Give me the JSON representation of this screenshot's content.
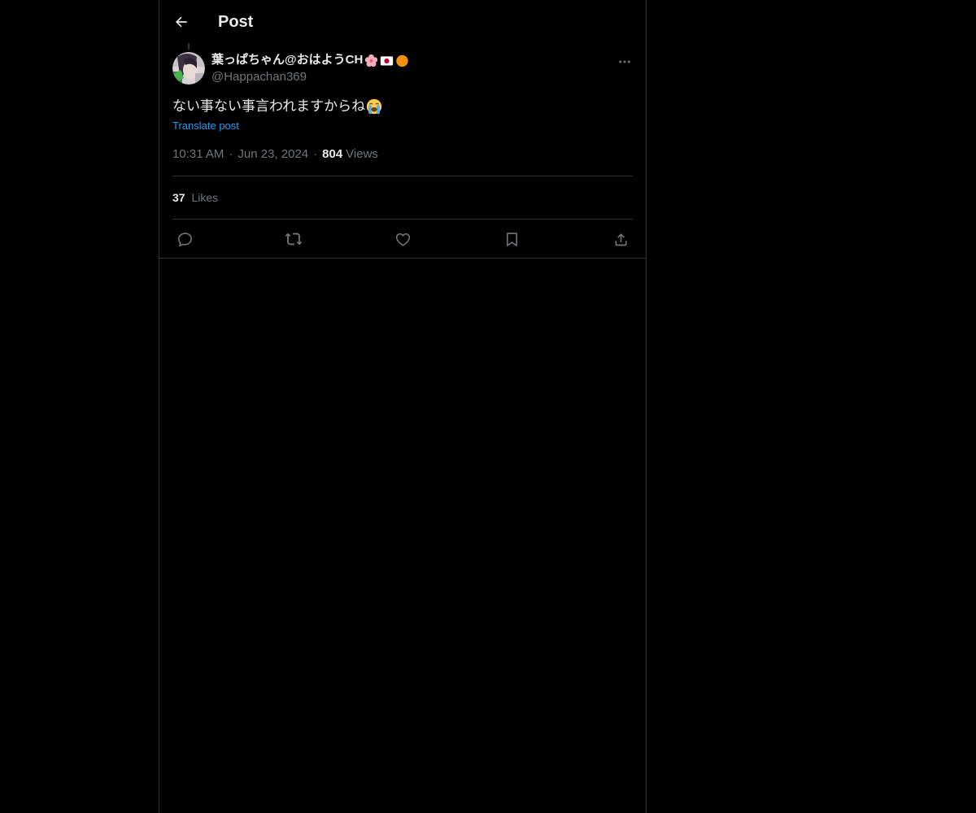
{
  "header": {
    "title": "Post",
    "back_icon": "arrow-left-icon"
  },
  "post": {
    "author": {
      "display_name": "葉っぱちゃん@おはようCH",
      "badges": [
        "cherry-blossom-emoji",
        "japan-flag-emoji",
        "orange-circle-emoji"
      ],
      "handle": "@Happachan369"
    },
    "text": "ない事ない事言われますからね",
    "text_emoji": "loudly-crying-face-emoji",
    "translate_label": "Translate post",
    "time": "10:31 AM",
    "date": "Jun 23, 2024",
    "separator": "·",
    "views_count": "804",
    "views_label": "Views",
    "likes_count": "37",
    "likes_label": "Likes"
  },
  "actions": [
    {
      "name": "reply",
      "icon": "reply-icon"
    },
    {
      "name": "repost",
      "icon": "repost-icon"
    },
    {
      "name": "like",
      "icon": "heart-icon"
    },
    {
      "name": "bookmark",
      "icon": "bookmark-icon"
    },
    {
      "name": "share",
      "icon": "share-icon"
    }
  ],
  "colors": {
    "background": "#000000",
    "text_primary": "#e7e9ea",
    "text_secondary": "#71767b",
    "accent": "#1d9bf0",
    "border": "#2f3336"
  }
}
